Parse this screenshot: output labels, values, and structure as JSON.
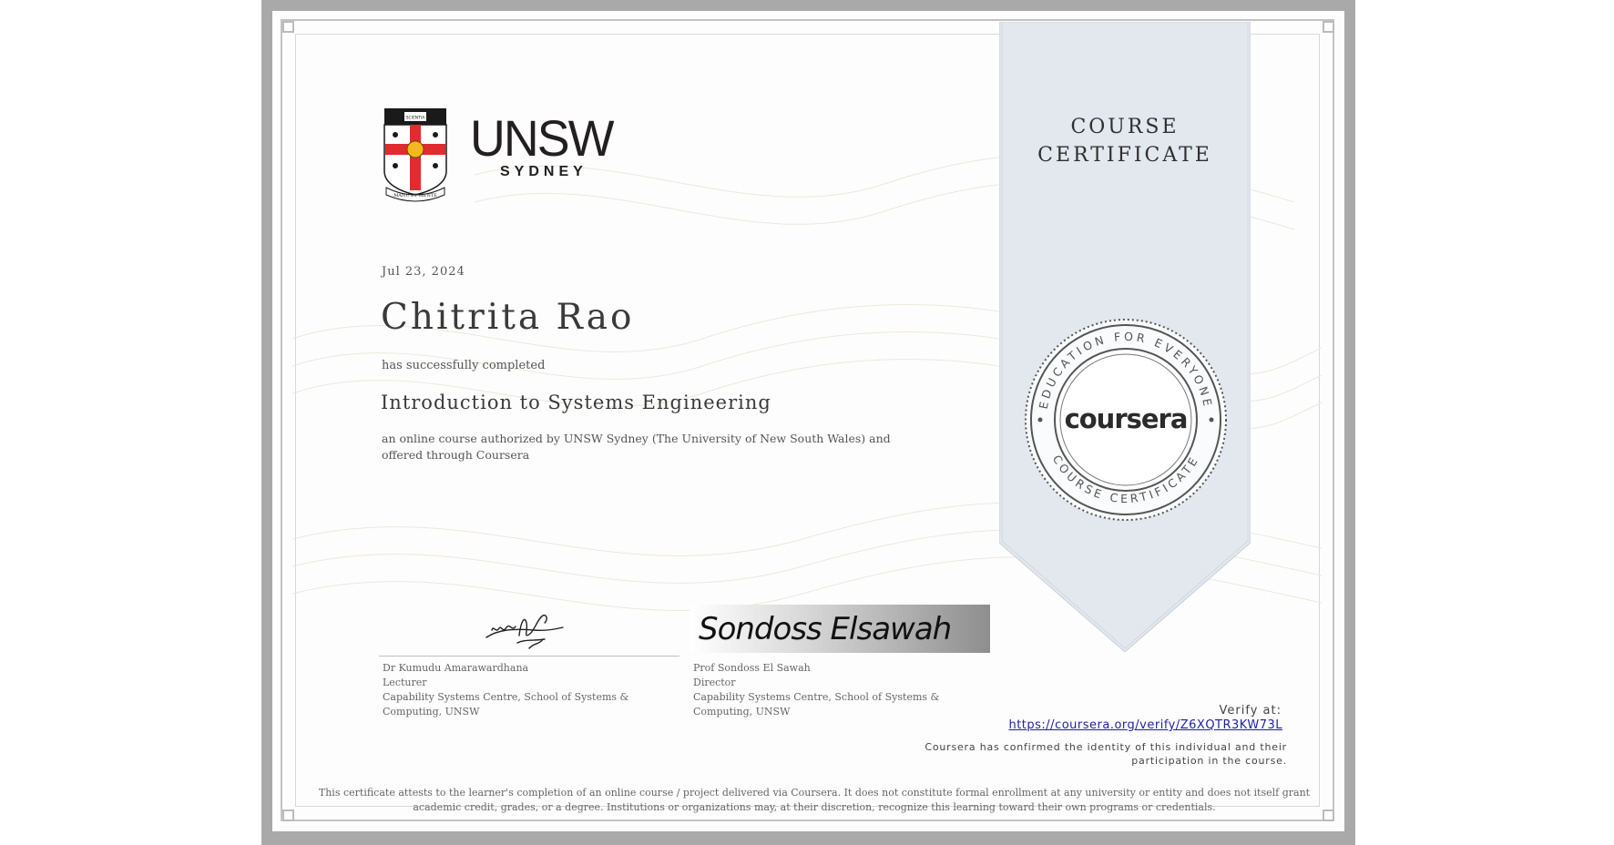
{
  "logo": {
    "word": "UNSW",
    "sub": "SYDNEY",
    "crest_book": "SCIENTIA",
    "crest_motto": "MANU ET MENTE"
  },
  "date": "Jul 23, 2024",
  "recipient": "Chitrita Rao",
  "completion_text": "has successfully completed",
  "course_title": "Introduction to Systems Engineering",
  "course_description": "an online course authorized by UNSW Sydney (The University of New South Wales) and offered through Coursera",
  "signatories": [
    {
      "name": "Dr Kumudu Amarawardhana",
      "role": "Lecturer",
      "affiliation": "Capability Systems Centre, School of Systems & Computing, UNSW"
    },
    {
      "name": "Prof Sondoss El Sawah",
      "role": "Director",
      "affiliation": "Capability Systems Centre, School of Systems & Computing, UNSW",
      "signature": "Sondoss Elsawah"
    }
  ],
  "badge": {
    "title_line1": "COURSE",
    "title_line2": "CERTIFICATE",
    "seal_top": "EDUCATION FOR EVERYONE",
    "seal_bottom": "COURSE CERTIFICATE",
    "seal_brand": "coursera"
  },
  "verify": {
    "label": "Verify at:",
    "url": "https://coursera.org/verify/Z6XQTR3KW73L",
    "note": "Coursera has confirmed the identity of this individual and their participation in the course."
  },
  "disclaimer": "This certificate attests to the learner's completion of an online course / project delivered via Coursera. It does not constitute formal enrollment at any university or entity and does not itself grant academic credit, grades, or a degree. Institutions or organizations may, at their discretion, recognize this learning toward their own programs or credentials.",
  "colors": {
    "banner": "#e3e7ee",
    "frame": "#a9a9a9",
    "crest_red": "#e02c2f",
    "link": "#1f1fa8"
  }
}
